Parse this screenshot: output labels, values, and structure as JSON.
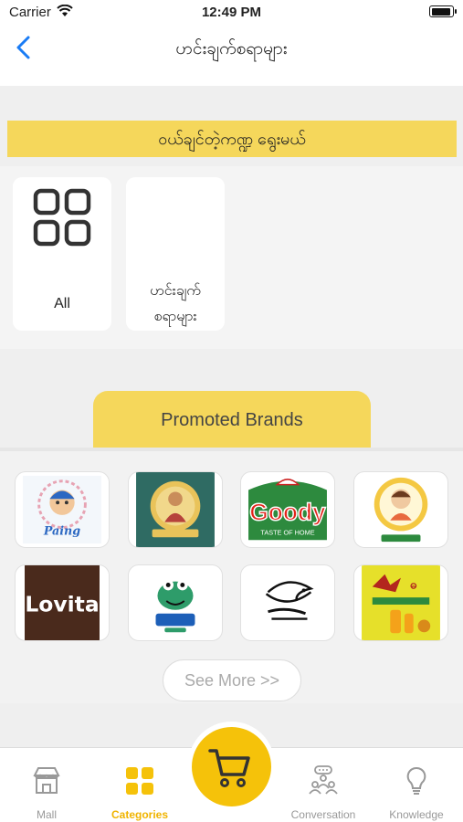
{
  "status_bar": {
    "carrier": "Carrier",
    "time": "12:49 PM"
  },
  "nav": {
    "title": "ဟင်းချက်စရာများ"
  },
  "banner": {
    "text": "ဝယ်ချင်တဲ့ကဏ္ဍ ရွေးမယ်"
  },
  "categories": [
    {
      "label": "All",
      "icon": "grid-icon"
    },
    {
      "label_line1": "ဟင်းချက်",
      "label_line2": "စရာများ"
    }
  ],
  "promoted": {
    "title": "Promoted Brands",
    "see_more": "See More >>",
    "brands": [
      {
        "name": "Paing",
        "icon": "paing-logo"
      },
      {
        "name": "",
        "icon": "lady-portrait-logo"
      },
      {
        "name": "Goody",
        "tagline": "TASTE OF HOME",
        "icon": "goody-logo"
      },
      {
        "name": "",
        "icon": "chef-girl-logo"
      },
      {
        "name": "Lovita",
        "icon": "lovita-logo"
      },
      {
        "name": "",
        "icon": "frog-mascot-logo"
      },
      {
        "name": "",
        "icon": "fish-brand-logo"
      },
      {
        "name": "",
        "icon": "eagle-oil-logo"
      }
    ]
  },
  "tabs": [
    {
      "label": "Mall",
      "icon": "store-icon",
      "active": false
    },
    {
      "label": "Categories",
      "icon": "categories-icon",
      "active": true
    },
    {
      "label": "Conversation",
      "icon": "conversation-icon",
      "active": false
    },
    {
      "label": "Knowledge",
      "icon": "lightbulb-icon",
      "active": false
    }
  ],
  "colors": {
    "accent": "#f5c20a",
    "banner": "#f5d75b",
    "link": "#1a7cf5"
  }
}
